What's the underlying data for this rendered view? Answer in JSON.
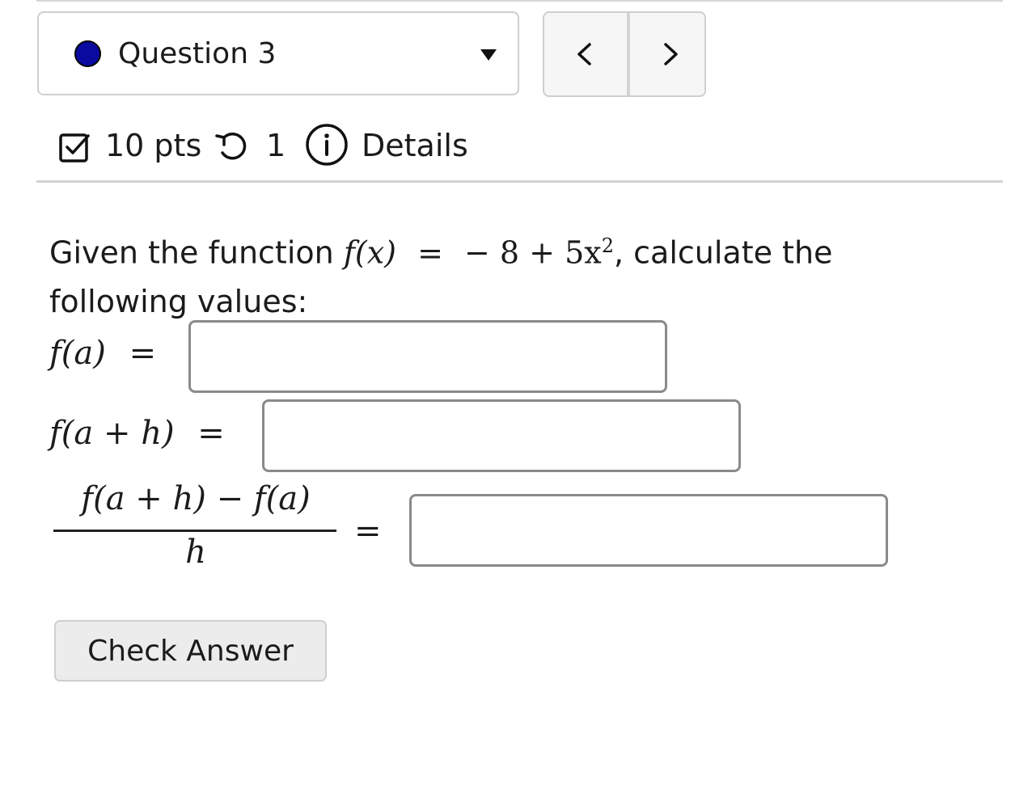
{
  "question_selector": {
    "label": "Question 3",
    "status_color": "#0a0aa0"
  },
  "navigation": {
    "prev_icon": "chevron-left-icon",
    "next_icon": "chevron-right-icon"
  },
  "meta": {
    "points": "10 pts",
    "attempts": "1",
    "details": "Details"
  },
  "question": {
    "intro": "Given the function",
    "function_lhs": "f(x)",
    "equals": "=",
    "function_rhs": "− 8 + 5x",
    "exponent": "2",
    "trailing": ", calculate the following values:"
  },
  "rows": {
    "f_a": "f(a)",
    "f_ah": "f(a + h)",
    "diff_num": "f(a + h) − f(a)",
    "diff_den": "h",
    "equals": "="
  },
  "inputs": [
    {
      "value": ""
    },
    {
      "value": ""
    },
    {
      "value": ""
    }
  ],
  "buttons": {
    "check": "Check Answer"
  }
}
